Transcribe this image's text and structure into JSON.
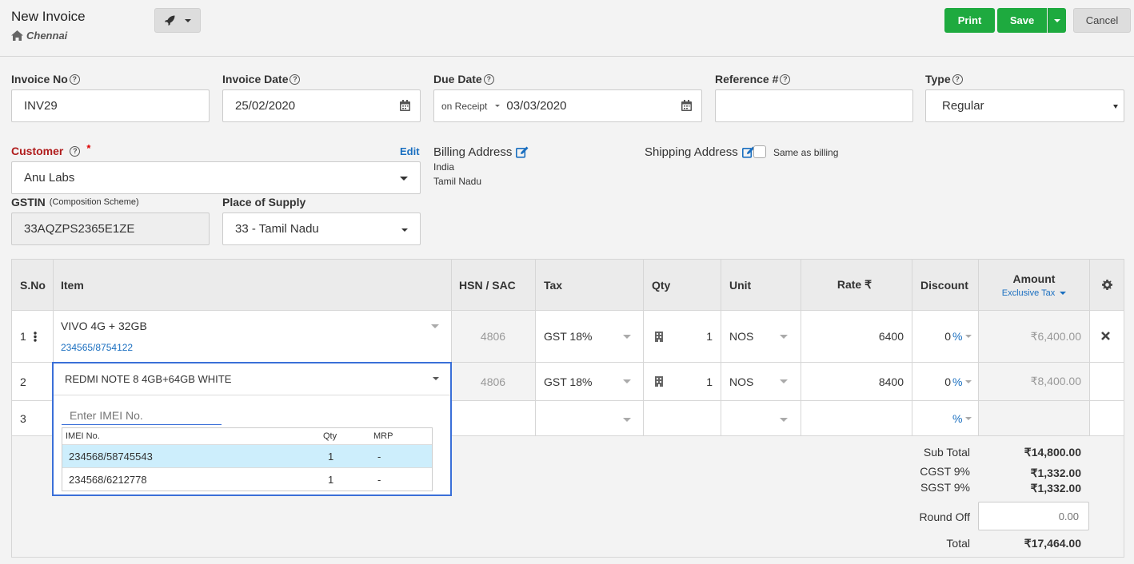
{
  "header": {
    "title": "New Invoice",
    "location": "Chennai",
    "print_label": "Print",
    "save_label": "Save",
    "cancel_label": "Cancel"
  },
  "form": {
    "invoice_no": {
      "label": "Invoice No",
      "value": "INV29"
    },
    "invoice_date": {
      "label": "Invoice Date",
      "value": "25/02/2020"
    },
    "due_date": {
      "label": "Due Date",
      "term": "on Receipt",
      "value": "03/03/2020"
    },
    "reference": {
      "label": "Reference #",
      "value": ""
    },
    "type": {
      "label": "Type",
      "value": "Regular"
    },
    "customer": {
      "label": "Customer",
      "required_mark": "*",
      "edit_label": "Edit",
      "value": "Anu Labs"
    },
    "gstin": {
      "label": "GSTIN",
      "sublabel": "(Composition Scheme)",
      "value": "33AQZPS2365E1ZE"
    },
    "place_of_supply": {
      "label": "Place of Supply",
      "value": "33 - Tamil Nadu"
    },
    "billing": {
      "label": "Billing Address",
      "line1": "India",
      "line2": "Tamil Nadu"
    },
    "shipping": {
      "label": "Shipping Address",
      "same_as_billing": "Same as billing",
      "checked": false
    }
  },
  "table": {
    "headers": {
      "sno": "S.No",
      "item": "Item",
      "hsn": "HSN / SAC",
      "tax": "Tax",
      "qty": "Qty",
      "unit": "Unit",
      "rate": "Rate ₹",
      "discount": "Discount",
      "amount": "Amount",
      "amount_mode": "Exclusive Tax"
    },
    "rows": [
      {
        "sno": "1",
        "item": "VIVO 4G + 32GB",
        "imei": "234565/8754122",
        "hsn": "4806",
        "tax": "GST 18%",
        "qty": "1",
        "unit": "NOS",
        "rate": "6400",
        "discount": "0",
        "disc_type": "%",
        "amount": "₹6,400.00"
      },
      {
        "sno": "2",
        "item": "REDMI NOTE 8 4GB+64GB WHITE",
        "hsn": "4806",
        "tax": "GST 18%",
        "qty": "1",
        "unit": "NOS",
        "rate": "8400",
        "discount": "0",
        "disc_type": "%",
        "amount": "₹8,400.00"
      },
      {
        "sno": "3",
        "disc_type": "%"
      }
    ],
    "imei_popup": {
      "placeholder": "Enter IMEI No.",
      "headers": {
        "imei": "IMEI No.",
        "qty": "Qty",
        "mrp": "MRP"
      },
      "items": [
        {
          "imei": "234568/58745543",
          "qty": "1",
          "mrp": "-",
          "selected": true
        },
        {
          "imei": "234568/6212778",
          "qty": "1",
          "mrp": "-",
          "selected": false
        }
      ]
    }
  },
  "totals": {
    "sub_total_label": "Sub Total",
    "sub_total": "₹14,800.00",
    "cgst_label": "CGST 9%",
    "cgst": "₹1,332.00",
    "sgst_label": "SGST 9%",
    "sgst": "₹1,332.00",
    "round_off_label": "Round Off",
    "round_off_placeholder": "0.00",
    "total_label": "Total",
    "total": "₹17,464.00"
  },
  "colors": {
    "primary_green": "#1eaa3f",
    "link_blue": "#1a6fc0",
    "focus_blue": "#3a6fd8",
    "selected_row": "#cdeefc",
    "required_red": "#b01c1c"
  }
}
